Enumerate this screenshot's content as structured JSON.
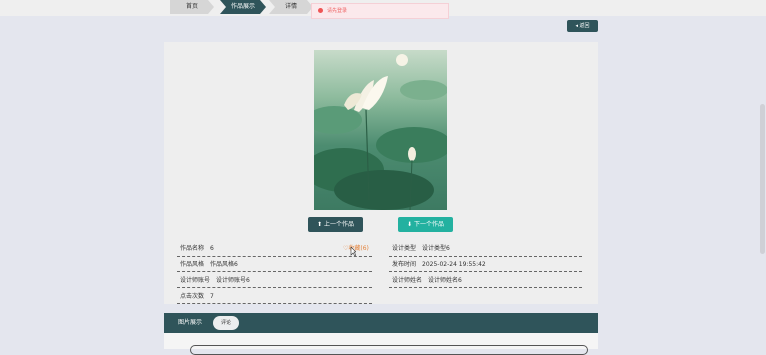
{
  "breadcrumb": {
    "home": "首页",
    "works": "作品展示",
    "detail": "详情"
  },
  "toast": {
    "text": "请先登录"
  },
  "back_button": {
    "label": "返回"
  },
  "nav": {
    "prev_label": "上一个作品",
    "next_label": "下一个作品"
  },
  "fields": {
    "name": {
      "label": "作品名称",
      "value": "6"
    },
    "favorite": "收藏(6)",
    "style": {
      "label": "作品风格",
      "value": "作品风格6"
    },
    "designer_account": {
      "label": "设计师账号",
      "value": "设计师账号6"
    },
    "click_count": {
      "label": "点击次数",
      "value": "7"
    },
    "design_type": {
      "label": "设计类型",
      "value": "设计类型6"
    },
    "publish_time": {
      "label": "发布时间",
      "value": "2025-02-24 19:55:42"
    },
    "designer_name": {
      "label": "设计师姓名",
      "value": "设计师姓名6"
    }
  },
  "tabs": {
    "gallery": "图片展示",
    "comment": "评论"
  },
  "colors": {
    "accent": "#2f545a",
    "teal": "#23b1a0",
    "favorite": "#e4833c"
  },
  "icons": {
    "back": "arrow-left-icon",
    "favorite": "heart-icon",
    "error": "error-dot-icon"
  }
}
